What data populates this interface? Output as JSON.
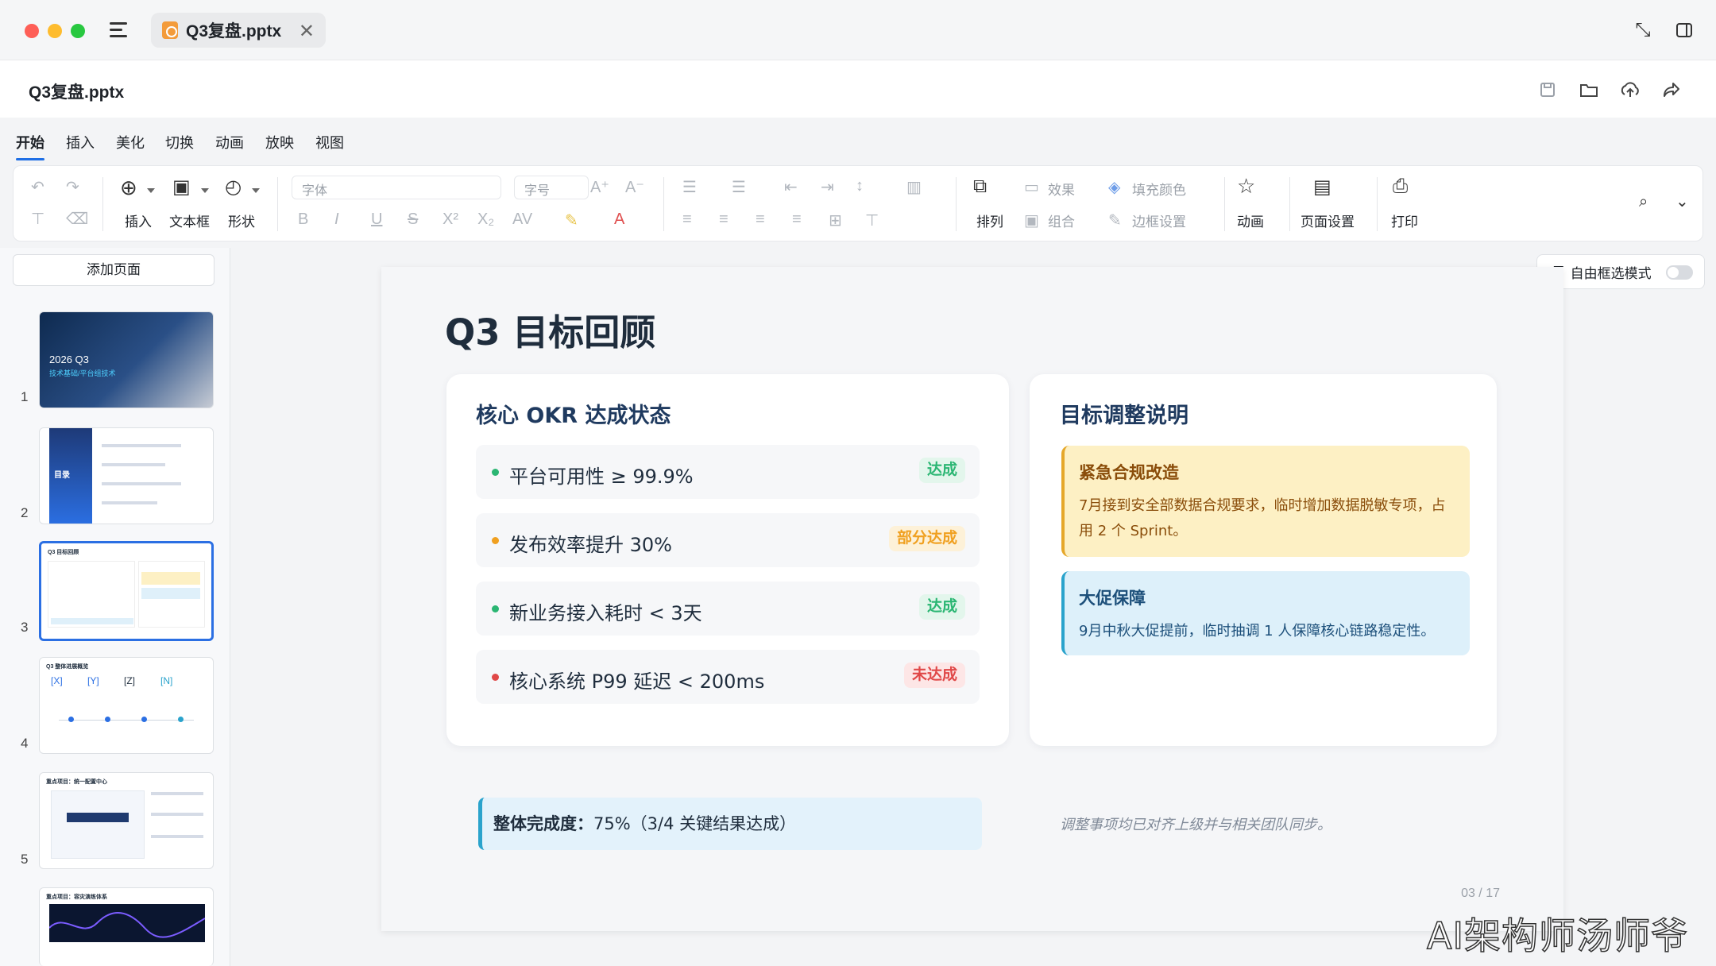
{
  "window": {
    "tab_label": "Q3复盘.pptx",
    "close_glyph": "✕",
    "minimize_glyph": "⤡",
    "sidebar_glyph": "▢"
  },
  "header": {
    "file_title": "Q3复盘.pptx",
    "icons": [
      "save-icon",
      "folder-icon",
      "upload-icon",
      "share-icon"
    ]
  },
  "menu": {
    "tabs": [
      "开始",
      "插入",
      "美化",
      "切换",
      "动画",
      "放映",
      "视图"
    ],
    "active": "开始"
  },
  "toolbar": {
    "undo": "↶",
    "redo": "↷",
    "insert": "插入",
    "textbox": "文本框",
    "shape": "形状",
    "font_placeholder": "字体",
    "size_placeholder": "字号",
    "font_grow": "A⁺",
    "font_shrink": "A⁻",
    "bold": "B",
    "italic": "I",
    "underline": "U",
    "strike": "S",
    "superscript": "X²",
    "subscript": "X₂",
    "arrange": "排列",
    "effect": "效果",
    "group": "组合",
    "fill_color": "填充颜色",
    "border": "边框设置",
    "animation": "动画",
    "page_setup": "页面设置",
    "print": "打印"
  },
  "sidebar": {
    "add_page": "添加页面",
    "thumbnails": [
      {
        "num": "1",
        "title": "2026 Q3",
        "subtitle": "技术基础/平台组技术"
      },
      {
        "num": "2",
        "title": "目录"
      },
      {
        "num": "3",
        "title": "Q3 目标回顾"
      },
      {
        "num": "4",
        "title": "Q3 整体进展概览",
        "labels": [
          "[X]",
          "[Y]",
          "[Z]",
          "[N]"
        ]
      },
      {
        "num": "5",
        "title": "重点项目：统一配置中心"
      },
      {
        "num": "6",
        "title": "重点项目：容灾演练体系"
      }
    ]
  },
  "freeframe": {
    "label": "自由框选模式"
  },
  "slide": {
    "title": "Q3 目标回顾",
    "left_card": {
      "title": "核心 OKR 达成状态",
      "items": [
        {
          "text": "平台可用性 ≥ 99.9%",
          "status": "达成",
          "color": "#2bb673"
        },
        {
          "text": "发布效率提升 30%",
          "status": "部分达成",
          "color": "#f0a020"
        },
        {
          "text": "新业务接入耗时 < 3天",
          "status": "达成",
          "color": "#2bb673"
        },
        {
          "text": "核心系统 P99 延迟 < 200ms",
          "status": "未达成",
          "color": "#e04848"
        }
      ],
      "summary_label": "整体完成度：",
      "summary_value": "75%（3/4 关键结果达成）"
    },
    "right_card": {
      "title": "目标调整说明",
      "notes": [
        {
          "title": "紧急合规改造",
          "text": "7月接到安全部数据合规要求，临时增加数据脱敏专项，占用 2 个 Sprint。"
        },
        {
          "title": "大促保障",
          "text": "9月中秋大促提前，临时抽调 1 人保障核心链路稳定性。"
        }
      ],
      "footnote": "调整事项均已对齐上级并与相关团队同步。"
    },
    "page_number": "03 / 17"
  },
  "watermark": "AI架构师汤师爷"
}
